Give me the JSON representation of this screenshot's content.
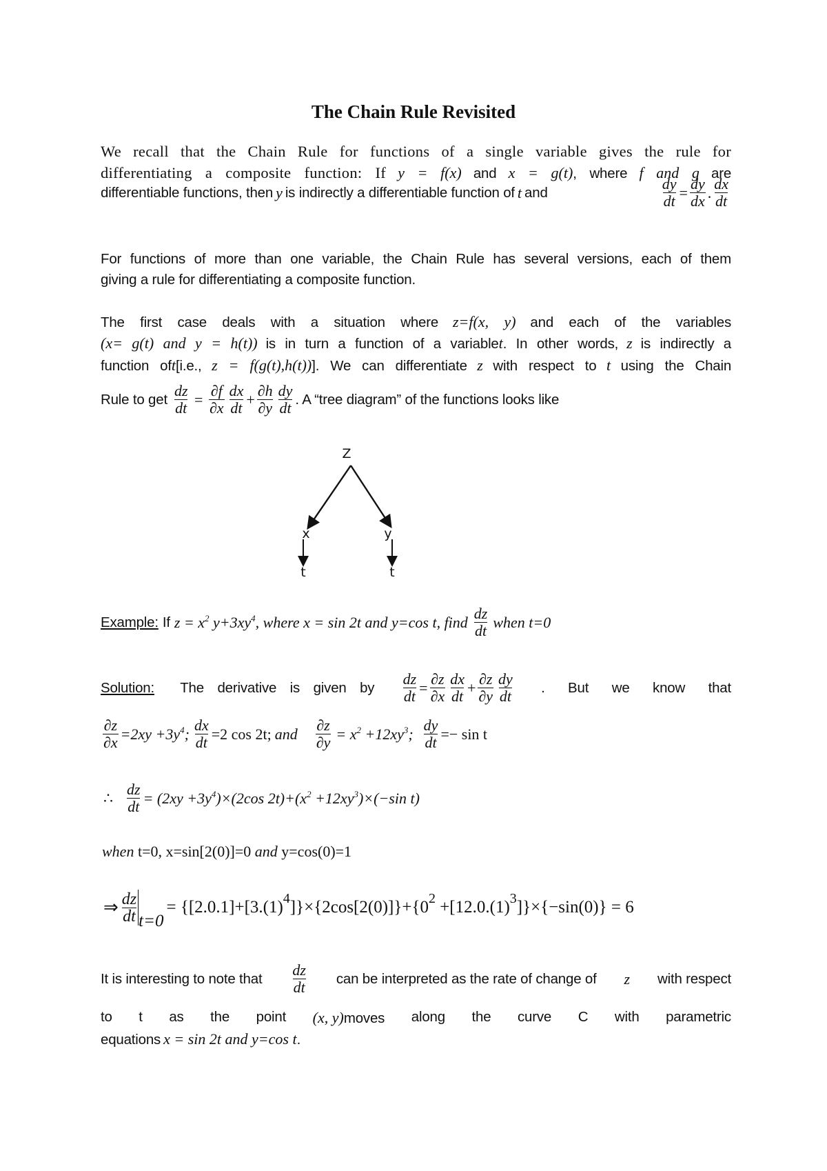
{
  "title": "The Chain Rule Revisited",
  "para1": {
    "line1": "We recall that the Chain Rule for functions of a single variable gives the rule for",
    "line2_a": "differentiating a composite function: If",
    "line2_eq1": "y = f(x)",
    "line2_b": "and",
    "line2_eq2": "x = g(t)",
    "line2_c": ", where",
    "line2_eq3": "f and g",
    "line2_d": "are",
    "line3_a": "differentiable functions, then",
    "line3_var_y": "y",
    "line3_b": "is indirectly a differentiable function of",
    "line3_var_t": "t",
    "line3_c": "and",
    "formula": {
      "lhs_num": "dy",
      "lhs_den": "dt",
      "r1_num": "dy",
      "r1_den": "dx",
      "r2_num": "dx",
      "r2_den": "dt"
    }
  },
  "para2": {
    "line1": "For functions of more than one variable, the Chain Rule has several versions, each of them",
    "line2": "giving a rule for differentiating a composite function."
  },
  "para3": {
    "line1_a": "The first case deals with a situation where",
    "line1_eq": "z=f(x, y)",
    "line1_b": "and each of the variables",
    "line2_eq": "(x= g(t) and  y = h(t))",
    "line2_a": "is in turn a function of a variable",
    "line2_t": "t",
    "line2_b": ". In other words,",
    "line2_z": "z",
    "line2_c": "is indirectly a",
    "line3_a": "function of",
    "line3_t": "t",
    "line3_b": "[i.e.,",
    "line3_eq": "z = f(g(t),h(t))",
    "line3_c": "]. We can differentiate",
    "line3_z": "z",
    "line3_d": "with respect to",
    "line3_t2": "t",
    "line3_e": "using the Chain",
    "line4_a": "Rule to get",
    "line4_b": ". A “tree diagram” of the functions looks like",
    "formula": {
      "lhs_num": "dz",
      "lhs_den": "dt",
      "a_num": "∂f",
      "a_den": "∂x",
      "b_num": "dx",
      "b_den": "dt",
      "c_num": "∂h",
      "c_den": "∂y",
      "d_num": "dy",
      "d_den": "dt"
    }
  },
  "tree": {
    "root": "Z",
    "left": "x",
    "right": "y",
    "left_leaf": "t",
    "right_leaf": "t"
  },
  "example": {
    "label": "Example:",
    "text_a": "If",
    "eq": "z = x² y+3xy⁴",
    "eq_base1": "z = x",
    "eq_sup1": "2",
    "eq_base2": " y+3xy",
    "eq_sup2": "4",
    "text_b": ", where  x = sin 2t  and  y=cos t,  find",
    "frac_num": "dz",
    "frac_den": "dt",
    "text_c": "when t=0"
  },
  "solution": {
    "label": "Solution:",
    "text_a": "The derivative is given by",
    "text_b": ". But we know that",
    "formula": {
      "lhs_num": "dz",
      "lhs_den": "dt",
      "a_num": "∂z",
      "a_den": "∂x",
      "b_num": "dx",
      "b_den": "dt",
      "c_num": "∂z",
      "c_den": "∂y",
      "d_num": "dy",
      "d_den": "dt"
    },
    "partials": {
      "p1_num": "∂z",
      "p1_den": "∂x",
      "p1_rhs_a": "=2xy +3y",
      "p1_rhs_sup": "4",
      "p1_rhs_b": ";",
      "p2_num": "dx",
      "p2_den": "dt",
      "p2_rhs": "=2 cos 2t;",
      "and": "and",
      "p3_num": "∂z",
      "p3_den": "∂y",
      "p3_rhs_a": "= x",
      "p3_rhs_sup1": "2",
      "p3_rhs_b": " +12xy",
      "p3_rhs_sup2": "3",
      "p3_rhs_c": ";",
      "p4_num": "dy",
      "p4_den": "dt",
      "p4_rhs": "=− sin t"
    },
    "therefore": "∴",
    "full": {
      "num": "dz",
      "den": "dt",
      "rhs_a": "= (2xy +3y",
      "sup1": "4",
      "rhs_b": ")×(2cos 2t)+(x",
      "sup2": "2",
      "rhs_c": " +12xy",
      "sup3": "3",
      "rhs_d": ")×(−sin t)"
    },
    "when_line": "when t=0, x=sin[2(0)]=0  and   y=cos(0)=1",
    "when_parts": {
      "w1": "when",
      "w2": " t=0, x=sin[2(0)]=0 ",
      "w3": "and",
      "w4": "  y=cos(0)=1"
    },
    "eval": {
      "arrow": "⇒",
      "num": "dz",
      "den": "dt",
      "at": "t=0",
      "rhs_a": "= {[2.0.1]+[3.(1)",
      "sup1": "4",
      "rhs_b": "]}×{2cos[2(0)]}+{0",
      "sup2": "2",
      "rhs_c": " +[12.0.(1)",
      "sup3": "3",
      "rhs_d": "]}×{−sin(0)} = 6"
    }
  },
  "closing": {
    "line1_a": "It is interesting to note that",
    "frac_num": "dz",
    "frac_den": "dt",
    "line1_b": "can be interpreted as the rate of change of",
    "line1_z": "z",
    "line1_c": "with respect",
    "line2_words": [
      "to",
      "t",
      "as",
      "the",
      "point",
      "(x, y)",
      "moves",
      "along",
      "the",
      "curve",
      "C",
      "with",
      "parametric"
    ],
    "line3_a": "equations",
    "line3_eq": "x = sin 2t  and   y=cos t",
    "line3_b": "."
  }
}
